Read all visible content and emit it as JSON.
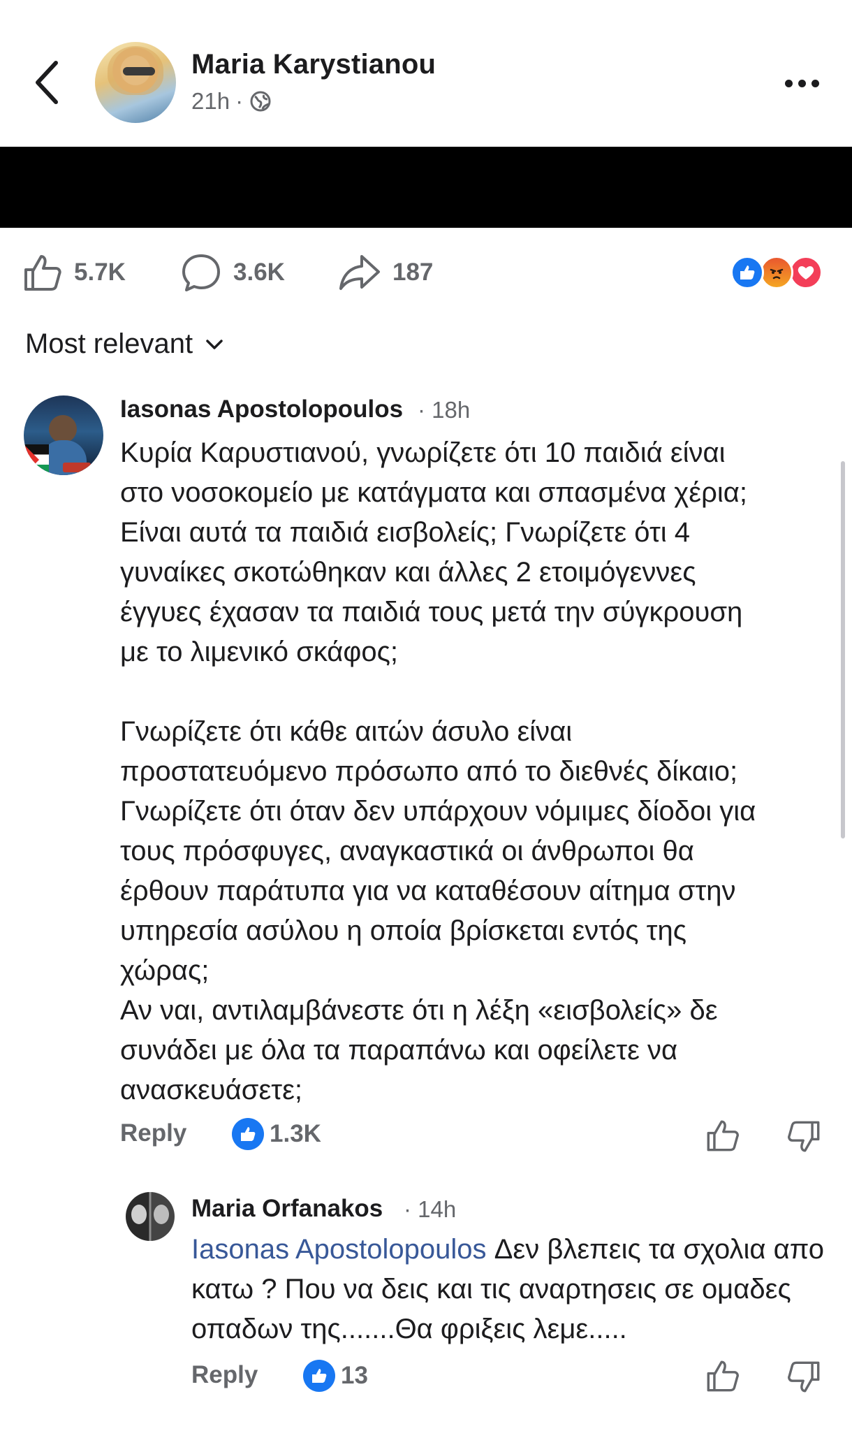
{
  "post": {
    "author": "Maria Karystianou",
    "time": "21h",
    "separator": "·",
    "audience_icon": "globe-icon"
  },
  "stats": {
    "likes": "5.7K",
    "comments": "3.6K",
    "shares": "187",
    "reactions": [
      "like-reaction-icon",
      "angry-reaction-icon",
      "love-reaction-icon"
    ]
  },
  "sort": {
    "label": "Most relevant"
  },
  "comments": [
    {
      "author": "Iasonas Apostolopoulos",
      "time": "· 18h",
      "text": "Κυρία Καρυστιανού, γνωρίζετε ότι 10 παιδιά είναι\nστο νοσοκομείο με κατάγματα και σπασμένα χέρια;\nΕίναι αυτά τα παιδιά εισβολείς; Γνωρίζετε ότι 4\nγυναίκες σκοτώθηκαν και άλλες 2 ετοιμόγεννες\nέγγυες έχασαν τα παιδιά τους μετά την σύγκρουση\nμε το λιμενικό σκάφος;\n\nΓνωρίζετε ότι κάθε αιτών άσυλο είναι\nπροστατευόμενο πρόσωπο από το διεθνές δίκαιο;\nΓνωρίζετε ότι όταν δεν υπάρχουν νόμιμες δίοδοι για\nτους πρόσφυγες, αναγκαστικά οι άνθρωποι θα\nέρθουν παράτυπα για να καταθέσουν αίτημα στην\nυπηρεσία ασύλου η οποία βρίσκεται εντός της\nχώρας;\nΑν ναι, αντιλαμβάνεστε ότι η λέξη «εισβολείς» δε\nσυνάδει με όλα τα παραπάνω και οφείλετε να\nανασκευάσετε;",
      "reply_label": "Reply",
      "like_count": "1.3K"
    },
    {
      "author": "Maria Orfanakos",
      "time": "· 14h",
      "mention": "Iasonas Apostolopoulos",
      "text": " Δεν βλεπεις τα σχολια απο κατω ? Που να δεις και τις αναρτησεις σε ομαδες οπαδων της.......Θα φριξεις λεμε.....",
      "reply_label": "Reply",
      "like_count": "13"
    }
  ],
  "colors": {
    "facebook_blue": "#1877f2",
    "mention_blue": "#385898",
    "secondary_text": "#65676b"
  }
}
